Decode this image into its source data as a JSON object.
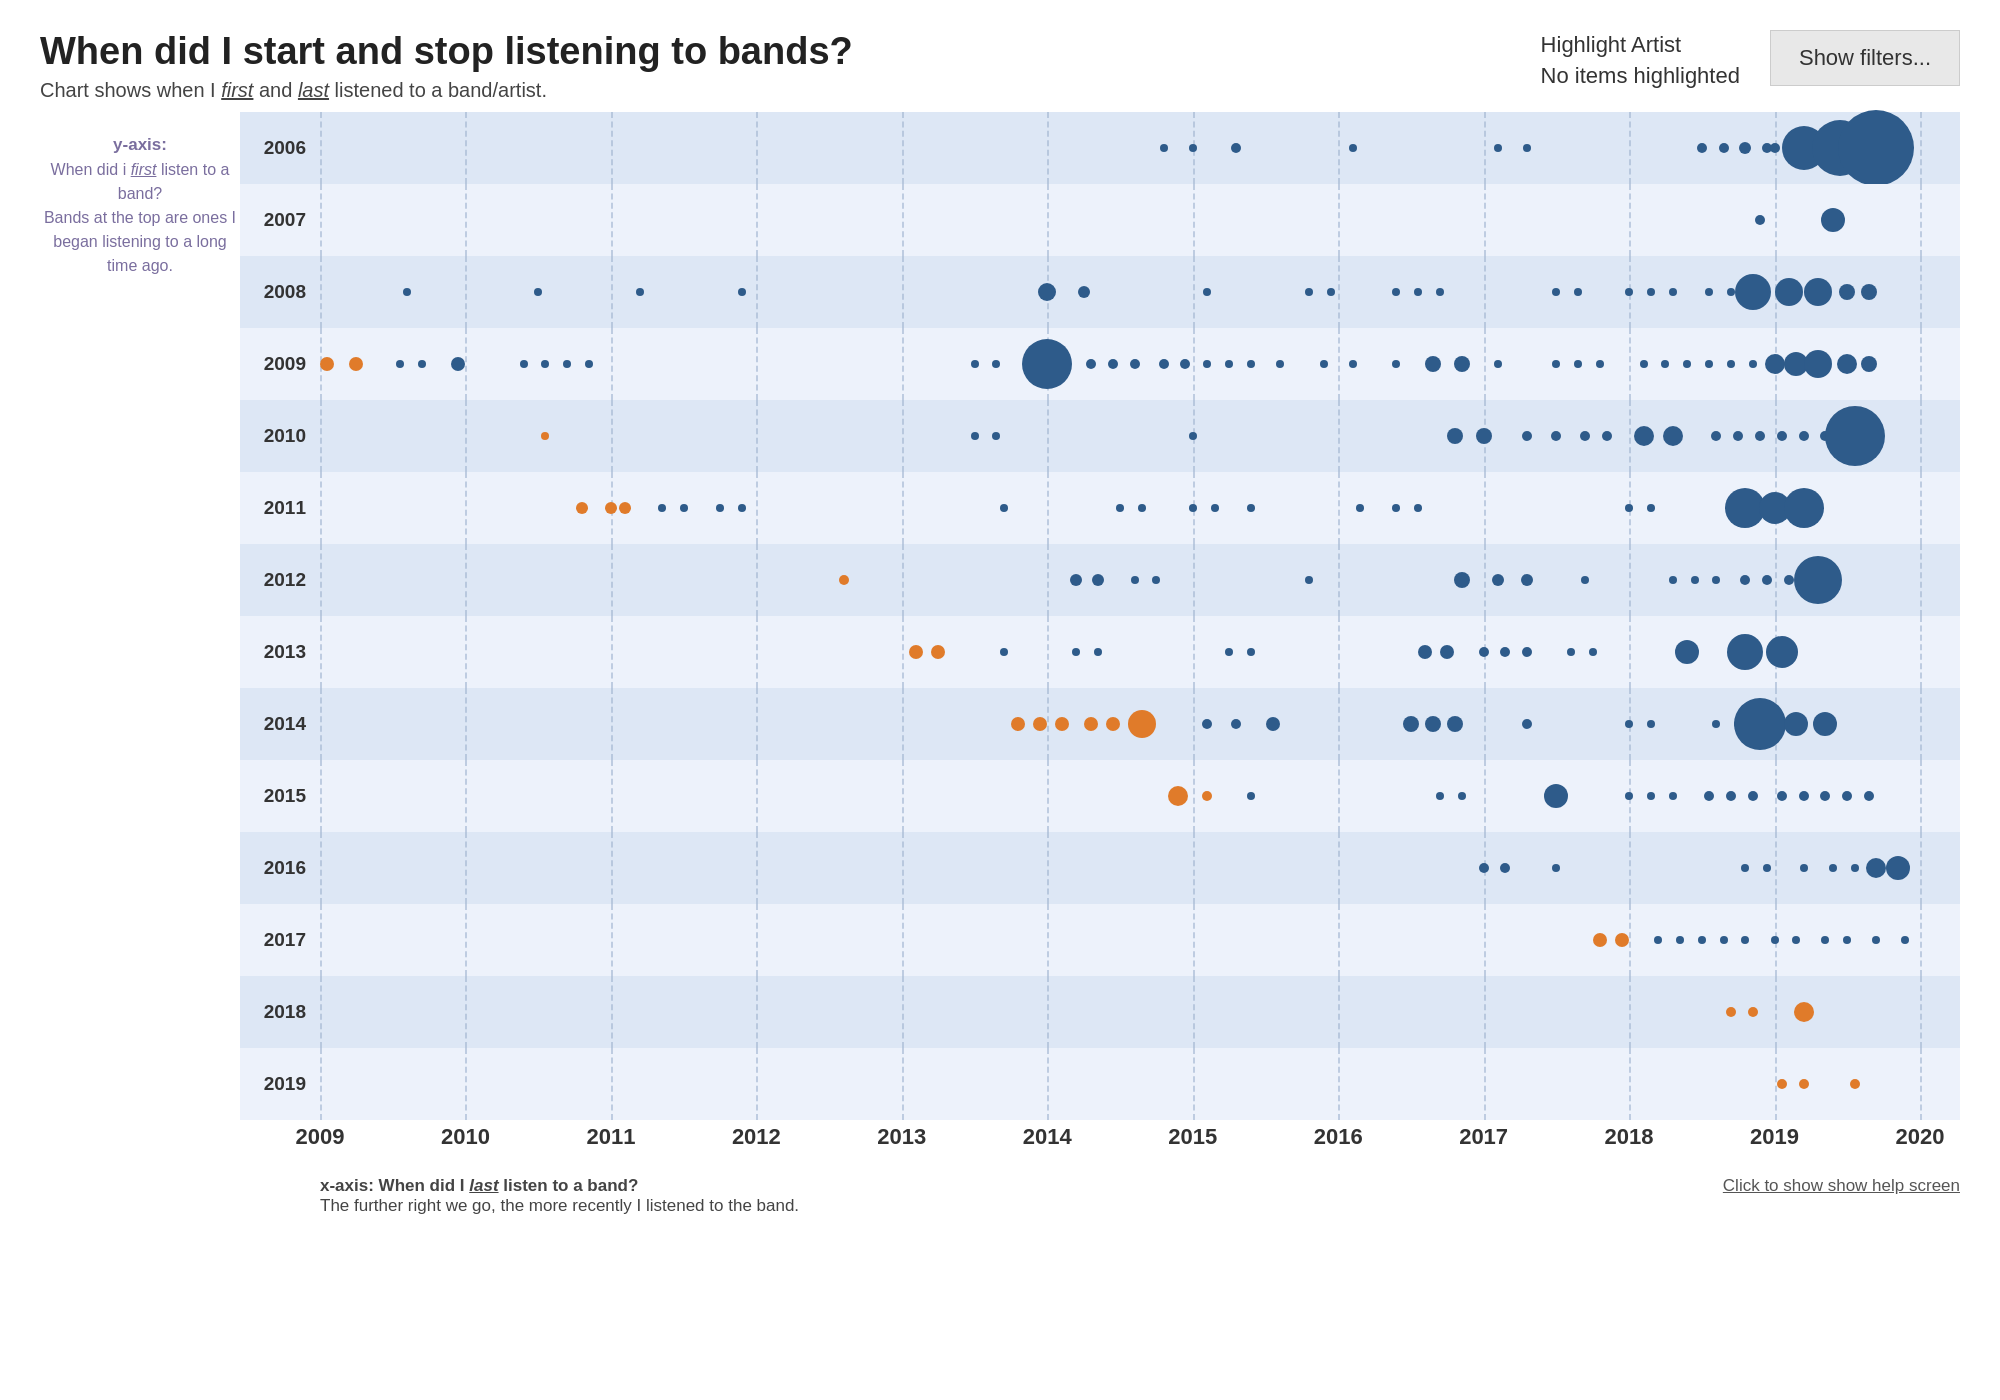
{
  "header": {
    "main_title": "When did I start and stop listening to bands?",
    "subtitle_pre": "Chart shows when I ",
    "subtitle_first": "first",
    "subtitle_mid": " and ",
    "subtitle_last": "last",
    "subtitle_post": " listened to a band/artist.",
    "highlight_label": "Highlight Artist\nNo items highlighted",
    "show_filters_label": "Show filters..."
  },
  "y_axis": {
    "title": "y-axis:",
    "desc1": "When did i ",
    "desc_first": "first",
    "desc2": " listen to a band?",
    "desc3": "Bands at the top are ones I began listening to a long time ago."
  },
  "x_axis": {
    "labels": [
      "2009",
      "2010",
      "2011",
      "2012",
      "2013",
      "2014",
      "2015",
      "2016",
      "2017",
      "2018",
      "2019",
      "2020"
    ],
    "description_pre": "x-axis: When did I ",
    "description_em": "last",
    "description_post": " listen to a band?",
    "description2": "The further right we go, the more recently I listened to the band.",
    "help_text": "Click to show show help screen"
  },
  "rows": [
    {
      "year": "2006",
      "shaded": true
    },
    {
      "year": "2007",
      "shaded": false
    },
    {
      "year": "2008",
      "shaded": true
    },
    {
      "year": "2009",
      "shaded": false
    },
    {
      "year": "2010",
      "shaded": true
    },
    {
      "year": "2011",
      "shaded": false
    },
    {
      "year": "2012",
      "shaded": true
    },
    {
      "year": "2013",
      "shaded": false
    },
    {
      "year": "2014",
      "shaded": true
    },
    {
      "year": "2015",
      "shaded": false
    },
    {
      "year": "2016",
      "shaded": true
    },
    {
      "year": "2017",
      "shaded": false
    },
    {
      "year": "2018",
      "shaded": true
    },
    {
      "year": "2019",
      "shaded": false
    }
  ],
  "colors": {
    "blue": "#2e5b8a",
    "orange": "#e07b2a",
    "shaded_row": "#d8e5f5",
    "unshaded_row": "#ebf0fa",
    "grid_line": "#a0b4d0",
    "accent_purple": "#7a6e9e"
  }
}
